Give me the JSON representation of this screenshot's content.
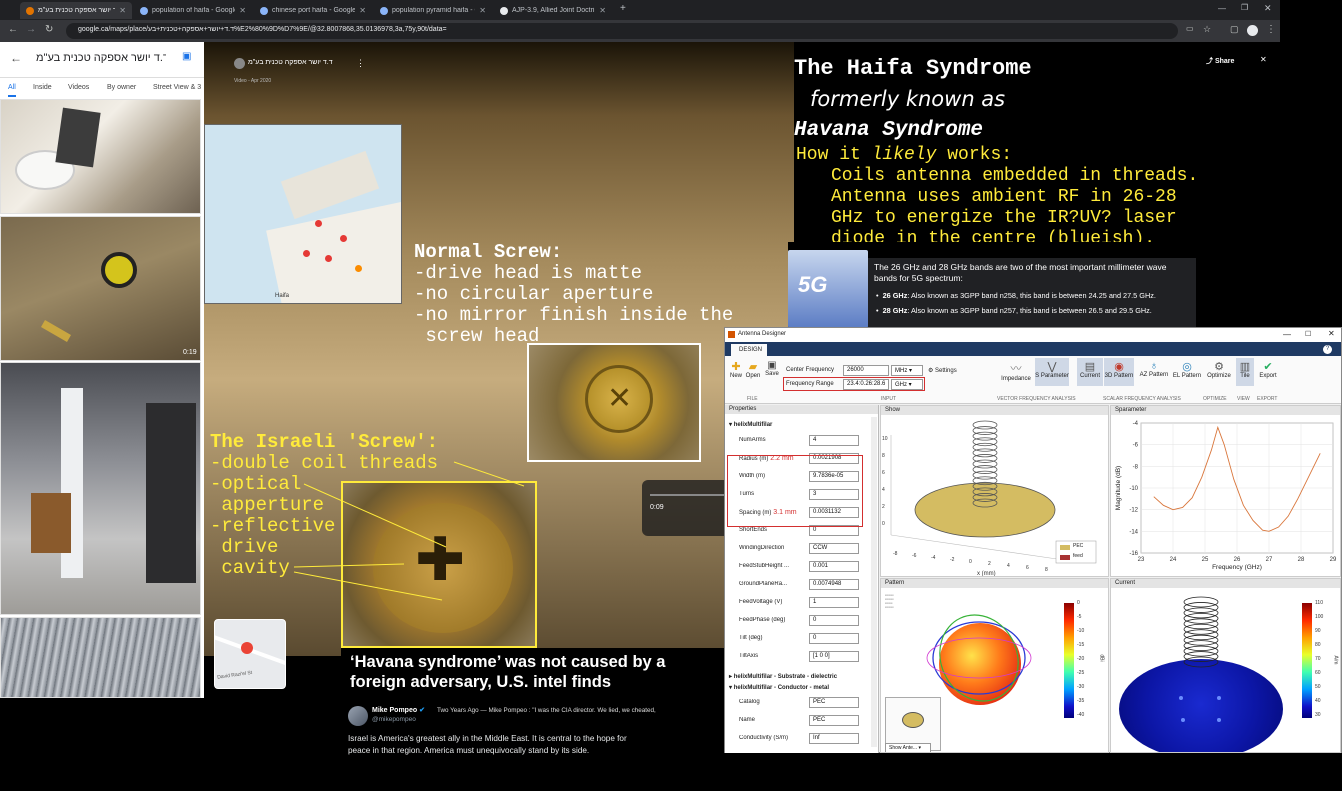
{
  "browser": {
    "tabs": [
      {
        "label": "ד.ד יושר אספקה טכנית בע\"מ - ..."
      },
      {
        "label": "population of haifa - Google Se..."
      },
      {
        "label": "chinese port haifa - Google Sea..."
      },
      {
        "label": "population pyramid haifa - Goo..."
      },
      {
        "label": "AJP-3.9, Allied Joint Doctrine fo..."
      }
    ],
    "url": "google.ca/maps/place/ד.ד+יושר+אספקה+טכנית+בע%E2%80%9D%D7%9E/@32.8007868,35.0136978,3a,75y,90t/data="
  },
  "maps": {
    "title": "ד.ד יושר אספקה טכנית בע\"מ",
    "filters": [
      "All",
      "Inside",
      "Videos",
      "By owner",
      "Street View & 3"
    ],
    "video_duration": "0:19",
    "street_label": "David Razi'el St"
  },
  "video": {
    "channel": "ד.ד יושר אספקה טכנית בע\"מ",
    "date": "Video - Apr 2020",
    "time": "0:09",
    "map_label": "Haifa"
  },
  "normal_screw": {
    "lines": [
      "Normal Screw:",
      "-drive head is matte",
      "-no circular aperture",
      "-no mirror finish inside the",
      " screw head"
    ]
  },
  "israeli_screw": {
    "lines": [
      "The Israeli 'Screw':",
      "-double coil threads",
      "-optical",
      " apperture",
      "-reflective",
      " drive",
      " cavity"
    ]
  },
  "overlay": {
    "title": "The Haifa Syndrome",
    "formerly": "formerly known as",
    "havana": "Havana Syndrome",
    "how_prefix": "How it ",
    "how_italic": "likely",
    "how_suffix": " works:",
    "body": [
      "Coils antenna embedded in threads.",
      "Antenna uses ambient RF in 26-28",
      "GHz to energize the IR?UV? laser",
      "diode in the centre (blueish)."
    ],
    "share": "Share"
  },
  "fiveg": {
    "logo": "5G",
    "intro": "The 26 GHz and 28 GHz bands are two of the most important millimeter wave bands for 5G spectrum:",
    "bullets": [
      {
        "bold": "26 GHz",
        "text": ": Also known as 3GPP band n258, this band is between 24.25 and 27.5 GHz."
      },
      {
        "bold": "28 GHz",
        "text": ": Also known as 3GPP band n257, this band is between 26.5 and 29.5 GHz."
      }
    ]
  },
  "antenna_designer": {
    "title": "Antenna Designer",
    "tab": "DESIGN",
    "toolbar": {
      "file": [
        "New",
        "Open",
        "Save"
      ],
      "file_group": "FILE",
      "center_freq_label": "Center Frequency",
      "center_freq_value": "26000",
      "center_freq_unit": "MHz",
      "settings": "Settings",
      "freq_range_label": "Frequency Range",
      "freq_range_value": "23.4:0.26:28.6",
      "freq_range_unit": "GHz",
      "input_group": "INPUT",
      "vfa": [
        "Impedance",
        "S Parameter"
      ],
      "vfa_group": "VECTOR FREQUENCY ANALYSIS",
      "sfa": [
        "Current",
        "3D Pattern",
        "AZ Pattern",
        "EL Pattern"
      ],
      "sfa_group": "SCALAR FREQUENCY ANALYSIS",
      "optimize": "Optimize",
      "optimize_group": "OPTIMIZE",
      "tile": "Tile",
      "view_group": "VIEW",
      "export": "Export",
      "export_group": "EXPORT"
    },
    "properties": {
      "header": "Properties",
      "section": "helixMultifilar",
      "rows": [
        {
          "label": "NumArms",
          "value": "4"
        },
        {
          "label": "Radius (m)",
          "note": "2.2 mm",
          "value": "0.0021908"
        },
        {
          "label": "Width (m)",
          "value": "9.7836e-05"
        },
        {
          "label": "Turns",
          "value": "3"
        },
        {
          "label": "Spacing (m)",
          "note": "3.1 mm",
          "value": "0.0031132"
        },
        {
          "label": "ShortEnds",
          "value": "0"
        },
        {
          "label": "WindingDirection",
          "value": "CCW"
        },
        {
          "label": "FeedStubHeight ...",
          "value": "0.001"
        },
        {
          "label": "GroundPlaneRa...",
          "value": "0.0074948"
        },
        {
          "label": "FeedVoltage (V)",
          "value": "1"
        },
        {
          "label": "FeedPhase (deg)",
          "value": "0"
        },
        {
          "label": "Tilt (deg)",
          "value": "0"
        },
        {
          "label": "TiltAxis",
          "value": "[1 0 0]"
        }
      ],
      "substrate": "helixMultifilar - Substrate - dielectric",
      "conductor": "helixMultifilar - Conductor - metal",
      "cond_rows": [
        {
          "label": "Catalog",
          "value": "PEC"
        },
        {
          "label": "Name",
          "value": "PEC"
        },
        {
          "label": "Conductivity (S/m)",
          "value": "Inf"
        }
      ]
    },
    "show_panel": {
      "title": "Show",
      "legend": [
        "PEC",
        "feed"
      ],
      "x_label": "x (mm)",
      "x_ticks": [
        "-8",
        "-6",
        "-4",
        "-2",
        "0",
        "2",
        "4",
        "6",
        "8"
      ],
      "z_ticks": [
        "10",
        "8",
        "6",
        "4",
        "2",
        "0"
      ]
    },
    "sparam_panel": {
      "title": "Sparameter"
    },
    "pattern_panel": {
      "title": "Pattern",
      "colorbar_ticks": [
        "0",
        "-5",
        "-10",
        "-15",
        "-20",
        "-25",
        "-30",
        "-35",
        "-40"
      ],
      "colorbar_unit": "dBi",
      "show_btn": "Show Ante..."
    },
    "current_panel": {
      "title": "Current",
      "colorbar_ticks": [
        "110",
        "100",
        "90",
        "80",
        "70",
        "60",
        "50",
        "40",
        "30"
      ],
      "colorbar_unit": "A/m"
    }
  },
  "chart_data": {
    "type": "line",
    "title": "",
    "xlabel": "Frequency (GHz)",
    "ylabel": "Magnitude (dB)",
    "xlim": [
      23,
      29
    ],
    "ylim": [
      -16,
      -4
    ],
    "xticks": [
      "23",
      "24",
      "25",
      "26",
      "27",
      "28",
      "29"
    ],
    "yticks": [
      "-4",
      "-6",
      "-8",
      "-10",
      "-12",
      "-14",
      "-16"
    ],
    "grid": true,
    "series": [
      {
        "color": "#d9763b",
        "x": [
          23.4,
          23.7,
          24.0,
          24.3,
          24.6,
          24.9,
          25.2,
          25.4,
          25.6,
          25.9,
          26.2,
          26.5,
          26.8,
          27.0,
          27.3,
          27.6,
          27.9,
          28.2,
          28.6
        ],
        "y": [
          -10.8,
          -11.6,
          -12.0,
          -11.8,
          -10.9,
          -9.0,
          -6.5,
          -4.4,
          -6.0,
          -9.2,
          -11.6,
          -13.0,
          -13.9,
          -14.0,
          -13.6,
          -12.6,
          -11.0,
          -9.2,
          -6.8
        ]
      }
    ]
  },
  "news": {
    "headline": "‘Havana syndrome’ was not caused by a foreign adversary, U.S. intel finds"
  },
  "tweet": {
    "name": "Mike Pompeo",
    "handle": "@mikepompeo",
    "context": "Two Years Ago — Mike Pompeo : \"I was the CIA director. We lied, we cheated,",
    "text": "Israel is America's greatest ally in the Middle East. It is central to the hope for peace in that region. America must unequivocally stand by its side."
  }
}
